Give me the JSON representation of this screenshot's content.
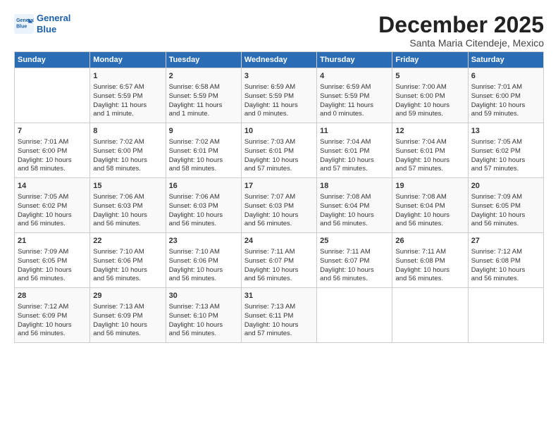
{
  "header": {
    "logo_line1": "General",
    "logo_line2": "Blue",
    "title": "December 2025",
    "subtitle": "Santa Maria Citendeje, Mexico"
  },
  "columns": [
    "Sunday",
    "Monday",
    "Tuesday",
    "Wednesday",
    "Thursday",
    "Friday",
    "Saturday"
  ],
  "weeks": [
    [
      {
        "day": "",
        "info": ""
      },
      {
        "day": "1",
        "info": "Sunrise: 6:57 AM\nSunset: 5:59 PM\nDaylight: 11 hours\nand 1 minute."
      },
      {
        "day": "2",
        "info": "Sunrise: 6:58 AM\nSunset: 5:59 PM\nDaylight: 11 hours\nand 1 minute."
      },
      {
        "day": "3",
        "info": "Sunrise: 6:59 AM\nSunset: 5:59 PM\nDaylight: 11 hours\nand 0 minutes."
      },
      {
        "day": "4",
        "info": "Sunrise: 6:59 AM\nSunset: 5:59 PM\nDaylight: 11 hours\nand 0 minutes."
      },
      {
        "day": "5",
        "info": "Sunrise: 7:00 AM\nSunset: 6:00 PM\nDaylight: 10 hours\nand 59 minutes."
      },
      {
        "day": "6",
        "info": "Sunrise: 7:01 AM\nSunset: 6:00 PM\nDaylight: 10 hours\nand 59 minutes."
      }
    ],
    [
      {
        "day": "7",
        "info": "Sunrise: 7:01 AM\nSunset: 6:00 PM\nDaylight: 10 hours\nand 58 minutes."
      },
      {
        "day": "8",
        "info": "Sunrise: 7:02 AM\nSunset: 6:00 PM\nDaylight: 10 hours\nand 58 minutes."
      },
      {
        "day": "9",
        "info": "Sunrise: 7:02 AM\nSunset: 6:01 PM\nDaylight: 10 hours\nand 58 minutes."
      },
      {
        "day": "10",
        "info": "Sunrise: 7:03 AM\nSunset: 6:01 PM\nDaylight: 10 hours\nand 57 minutes."
      },
      {
        "day": "11",
        "info": "Sunrise: 7:04 AM\nSunset: 6:01 PM\nDaylight: 10 hours\nand 57 minutes."
      },
      {
        "day": "12",
        "info": "Sunrise: 7:04 AM\nSunset: 6:01 PM\nDaylight: 10 hours\nand 57 minutes."
      },
      {
        "day": "13",
        "info": "Sunrise: 7:05 AM\nSunset: 6:02 PM\nDaylight: 10 hours\nand 57 minutes."
      }
    ],
    [
      {
        "day": "14",
        "info": "Sunrise: 7:05 AM\nSunset: 6:02 PM\nDaylight: 10 hours\nand 56 minutes."
      },
      {
        "day": "15",
        "info": "Sunrise: 7:06 AM\nSunset: 6:03 PM\nDaylight: 10 hours\nand 56 minutes."
      },
      {
        "day": "16",
        "info": "Sunrise: 7:06 AM\nSunset: 6:03 PM\nDaylight: 10 hours\nand 56 minutes."
      },
      {
        "day": "17",
        "info": "Sunrise: 7:07 AM\nSunset: 6:03 PM\nDaylight: 10 hours\nand 56 minutes."
      },
      {
        "day": "18",
        "info": "Sunrise: 7:08 AM\nSunset: 6:04 PM\nDaylight: 10 hours\nand 56 minutes."
      },
      {
        "day": "19",
        "info": "Sunrise: 7:08 AM\nSunset: 6:04 PM\nDaylight: 10 hours\nand 56 minutes."
      },
      {
        "day": "20",
        "info": "Sunrise: 7:09 AM\nSunset: 6:05 PM\nDaylight: 10 hours\nand 56 minutes."
      }
    ],
    [
      {
        "day": "21",
        "info": "Sunrise: 7:09 AM\nSunset: 6:05 PM\nDaylight: 10 hours\nand 56 minutes."
      },
      {
        "day": "22",
        "info": "Sunrise: 7:10 AM\nSunset: 6:06 PM\nDaylight: 10 hours\nand 56 minutes."
      },
      {
        "day": "23",
        "info": "Sunrise: 7:10 AM\nSunset: 6:06 PM\nDaylight: 10 hours\nand 56 minutes."
      },
      {
        "day": "24",
        "info": "Sunrise: 7:11 AM\nSunset: 6:07 PM\nDaylight: 10 hours\nand 56 minutes."
      },
      {
        "day": "25",
        "info": "Sunrise: 7:11 AM\nSunset: 6:07 PM\nDaylight: 10 hours\nand 56 minutes."
      },
      {
        "day": "26",
        "info": "Sunrise: 7:11 AM\nSunset: 6:08 PM\nDaylight: 10 hours\nand 56 minutes."
      },
      {
        "day": "27",
        "info": "Sunrise: 7:12 AM\nSunset: 6:08 PM\nDaylight: 10 hours\nand 56 minutes."
      }
    ],
    [
      {
        "day": "28",
        "info": "Sunrise: 7:12 AM\nSunset: 6:09 PM\nDaylight: 10 hours\nand 56 minutes."
      },
      {
        "day": "29",
        "info": "Sunrise: 7:13 AM\nSunset: 6:09 PM\nDaylight: 10 hours\nand 56 minutes."
      },
      {
        "day": "30",
        "info": "Sunrise: 7:13 AM\nSunset: 6:10 PM\nDaylight: 10 hours\nand 56 minutes."
      },
      {
        "day": "31",
        "info": "Sunrise: 7:13 AM\nSunset: 6:11 PM\nDaylight: 10 hours\nand 57 minutes."
      },
      {
        "day": "",
        "info": ""
      },
      {
        "day": "",
        "info": ""
      },
      {
        "day": "",
        "info": ""
      }
    ]
  ]
}
